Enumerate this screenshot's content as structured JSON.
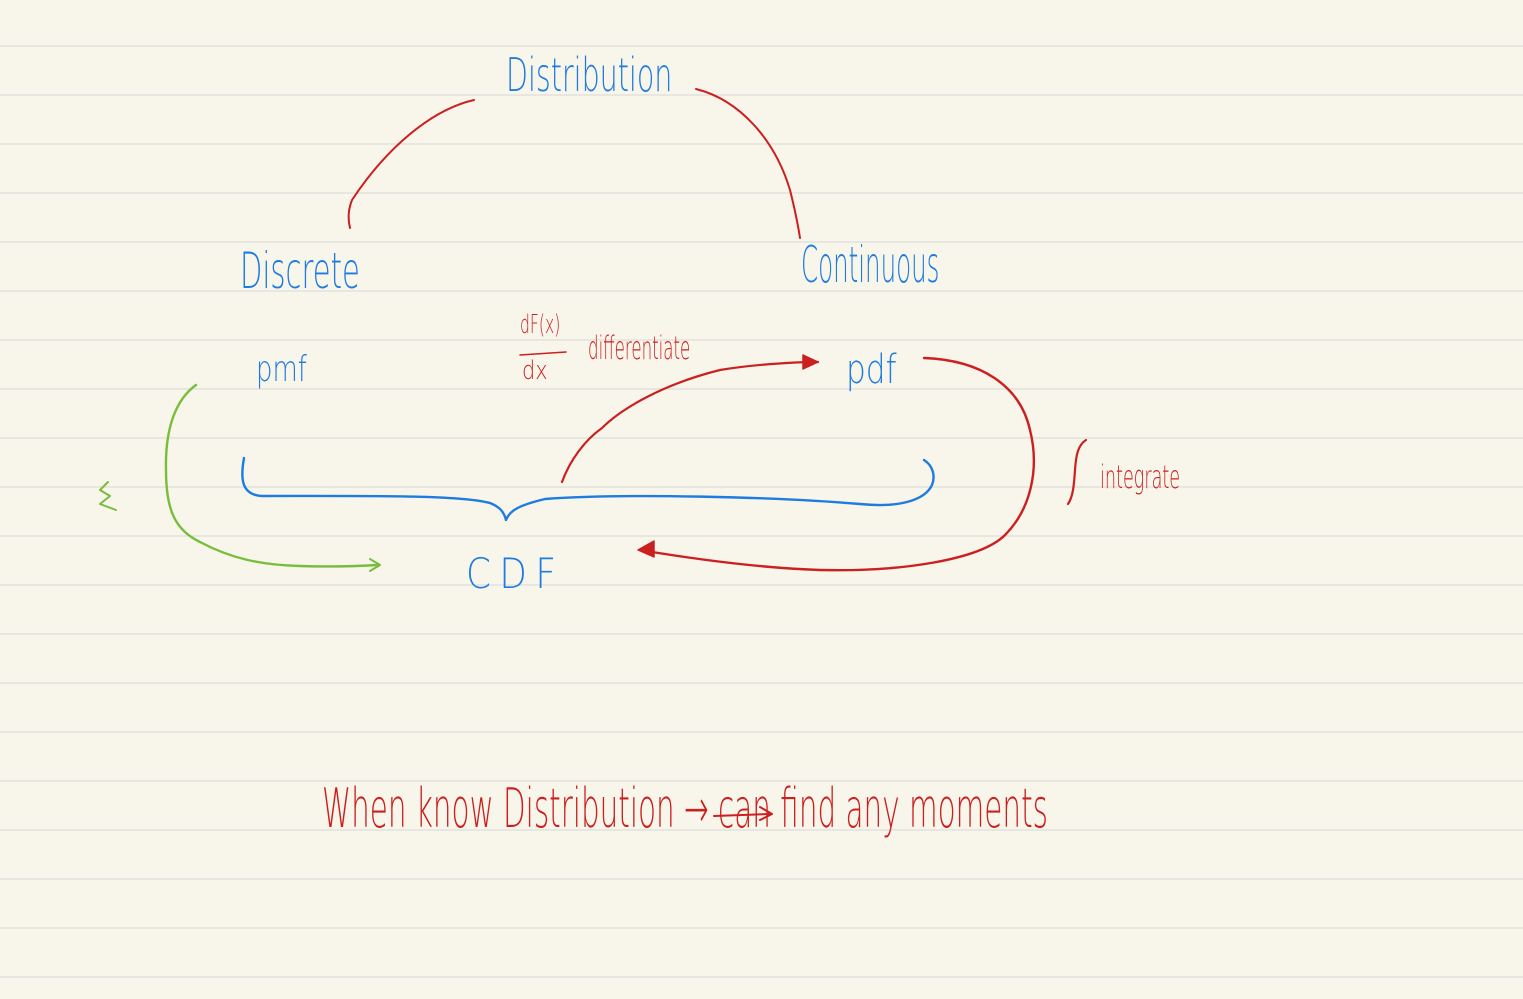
{
  "colors": {
    "paper": "#f8f5ea",
    "rule_line": "#d6d6d6",
    "ink_blue": "#1e7be0",
    "ink_red": "#cc1f1f",
    "ink_green": "#78bd3c"
  },
  "nodes": {
    "distribution": "Distribution",
    "discrete": "Discrete",
    "continuous": "Continuous",
    "pmf": "pmf",
    "pdf": "pdf",
    "cdf": "CDF"
  },
  "annotations": {
    "derivative_numerator": "dF(x)",
    "derivative_denominator": "dx",
    "differentiate": "differentiate",
    "integral_symbol": "∫",
    "integrate": "integrate",
    "sum_symbol": "Σ"
  },
  "footer_note": {
    "text": "When know Distribution → can find any moments"
  }
}
